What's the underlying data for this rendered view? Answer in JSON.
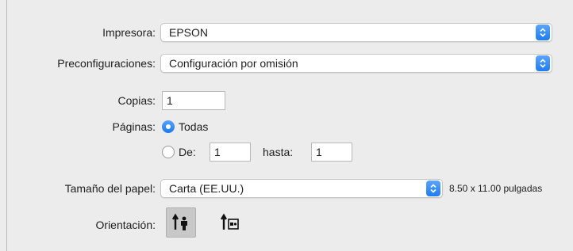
{
  "printer": {
    "label": "Impresora:",
    "value": "EPSON"
  },
  "presets": {
    "label": "Preconfiguraciones:",
    "value": "Configuración por omisión"
  },
  "copies": {
    "label": "Copias:",
    "value": "1"
  },
  "pages": {
    "label": "Páginas:",
    "all_label": "Todas",
    "all_selected": true,
    "from_label": "De:",
    "from_value": "1",
    "to_label": "hasta:",
    "to_value": "1"
  },
  "paper_size": {
    "label": "Tamaño del papel:",
    "value": "Carta (EE.UU.)",
    "dimensions": "8.50 x 11.00 pulgadas"
  },
  "orientation": {
    "label": "Orientación:",
    "options": [
      {
        "icon": "portrait-orientation-icon",
        "selected": true
      },
      {
        "icon": "landscape-orientation-icon",
        "selected": false
      }
    ]
  },
  "colors": {
    "accent": "#1f7cf2",
    "background": "#ececec"
  }
}
